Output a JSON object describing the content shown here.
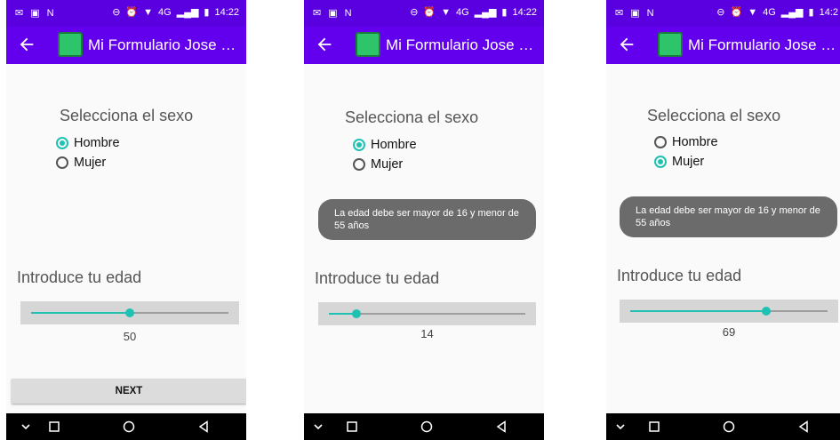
{
  "status_bar": {
    "left_icons": [
      "gmail-icon",
      "image-icon",
      "n-icon"
    ],
    "network": "4G",
    "screens_time": [
      "14:22",
      "14:22",
      "14:2"
    ]
  },
  "app_bar": {
    "title": "Mi Formulario Jose Ro..."
  },
  "form": {
    "sex_title": "Selecciona el sexo",
    "option_male": "Hombre",
    "option_female": "Mujer",
    "age_title": "Introduce tu edad",
    "next_label": "NEXT"
  },
  "toast": {
    "message": "La edad debe ser mayor de 16 y menor de 55 años"
  },
  "screens": [
    {
      "selected": "Hombre",
      "age": 50,
      "age_fraction": 0.5,
      "toast": false,
      "next": true
    },
    {
      "selected": "Hombre",
      "age": 14,
      "age_fraction": 0.14,
      "toast": true,
      "next": false
    },
    {
      "selected": "Mujer",
      "age": 69,
      "age_fraction": 0.69,
      "toast": true,
      "next": false
    }
  ],
  "colors": {
    "status": "#5a00e0",
    "app_bar": "#6200ee",
    "accent": "#1fc2b2",
    "toast": "#6b6b6b"
  }
}
